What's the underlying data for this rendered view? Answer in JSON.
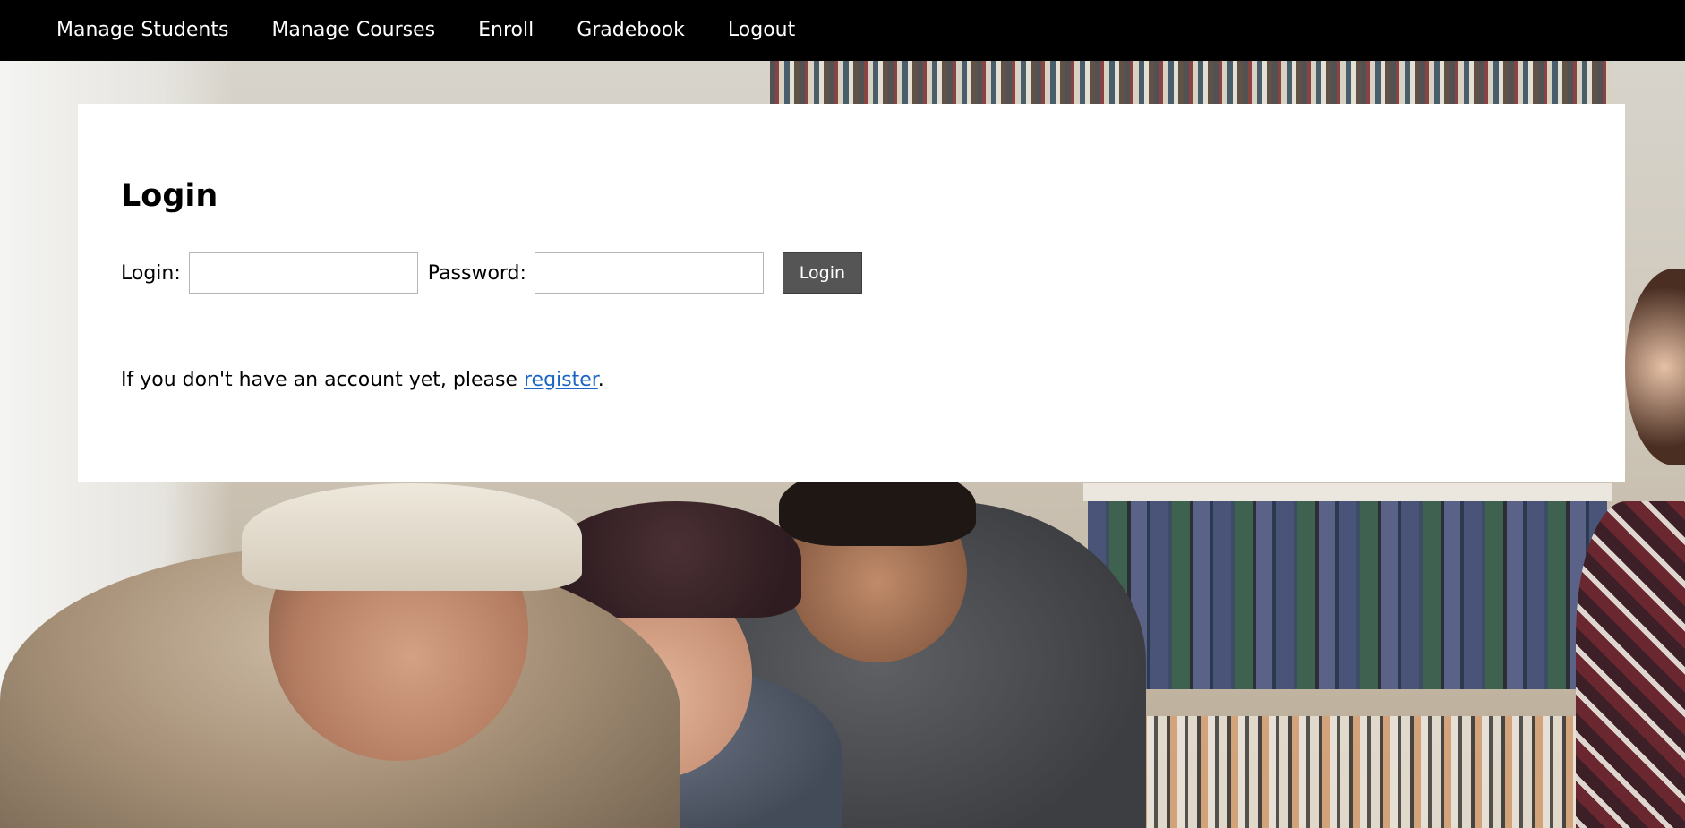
{
  "navbar": {
    "items": [
      {
        "label": "Manage Students"
      },
      {
        "label": "Manage Courses"
      },
      {
        "label": "Enroll"
      },
      {
        "label": "Gradebook"
      },
      {
        "label": "Logout"
      }
    ]
  },
  "login_card": {
    "title": "Login",
    "login_label": "Login:",
    "login_value": "",
    "password_label": "Password:",
    "password_value": "",
    "submit_label": "Login",
    "register_prefix": "If you don't have an account yet, please ",
    "register_link": "register",
    "register_suffix": "."
  },
  "colors": {
    "navbar_bg": "#000000",
    "button_bg": "#555555",
    "link": "#1a66c5"
  }
}
